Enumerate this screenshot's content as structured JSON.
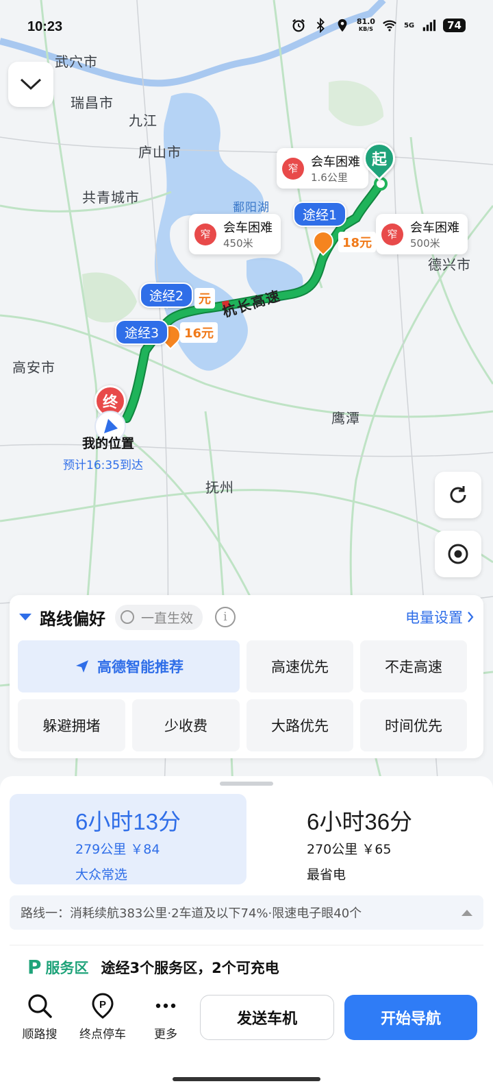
{
  "status_bar": {
    "time": "10:23",
    "net_speed": "81.0",
    "net_unit": "KB/S",
    "network": "5G",
    "battery": "74"
  },
  "map": {
    "cities": [
      "武穴市",
      "瑞昌市",
      "九江",
      "庐山市",
      "共青城市",
      "德兴市",
      "高安市",
      "鹰潭",
      "抚州"
    ],
    "lake": "鄱阳湖",
    "road": "杭长高速",
    "callouts": [
      {
        "badge": "窄",
        "title": "会车困难",
        "dist": "1.6公里"
      },
      {
        "badge": "窄",
        "title": "会车困难",
        "dist": "450米"
      },
      {
        "badge": "窄",
        "title": "会车困难",
        "dist": "500米"
      }
    ],
    "waypoints": [
      "途经1",
      "途经2",
      "途经3"
    ],
    "tolls": [
      "18元",
      "元",
      "16元"
    ],
    "start_label": "起",
    "end_label": "终",
    "my_location": "我的位置",
    "eta": "预计16:35到达"
  },
  "preferences": {
    "title": "路线偏好",
    "always_label": "一直生效",
    "info": "i",
    "battery_settings": "电量设置",
    "options": [
      "高德智能推荐",
      "高速优先",
      "不走高速",
      "躲避拥堵",
      "少收费",
      "大路优先",
      "时间优先"
    ]
  },
  "routes": [
    {
      "duration": "6小时13分",
      "distance": "279公里 ￥84",
      "tag": "大众常选"
    },
    {
      "duration": "6小时36分",
      "distance": "270公里 ￥65",
      "tag": "最省电"
    }
  ],
  "route_summary": "路线一：消耗续航383公里·2车道及以下74%·限速电子眼40个",
  "service": {
    "icon": "P",
    "label": "服务区",
    "text": "途经3个服务区，2个可充电"
  },
  "toolbar": {
    "search_along": "顺路搜",
    "parking": "终点停车",
    "more": "更多",
    "send_to_car": "发送车机",
    "start_nav": "开始导航"
  },
  "colors": {
    "accent": "#2f6ee8",
    "route_green": "#1fb35a",
    "toll_orange": "#f5841f",
    "warning_red": "#e84a4a",
    "service_green": "#1fa37a"
  }
}
